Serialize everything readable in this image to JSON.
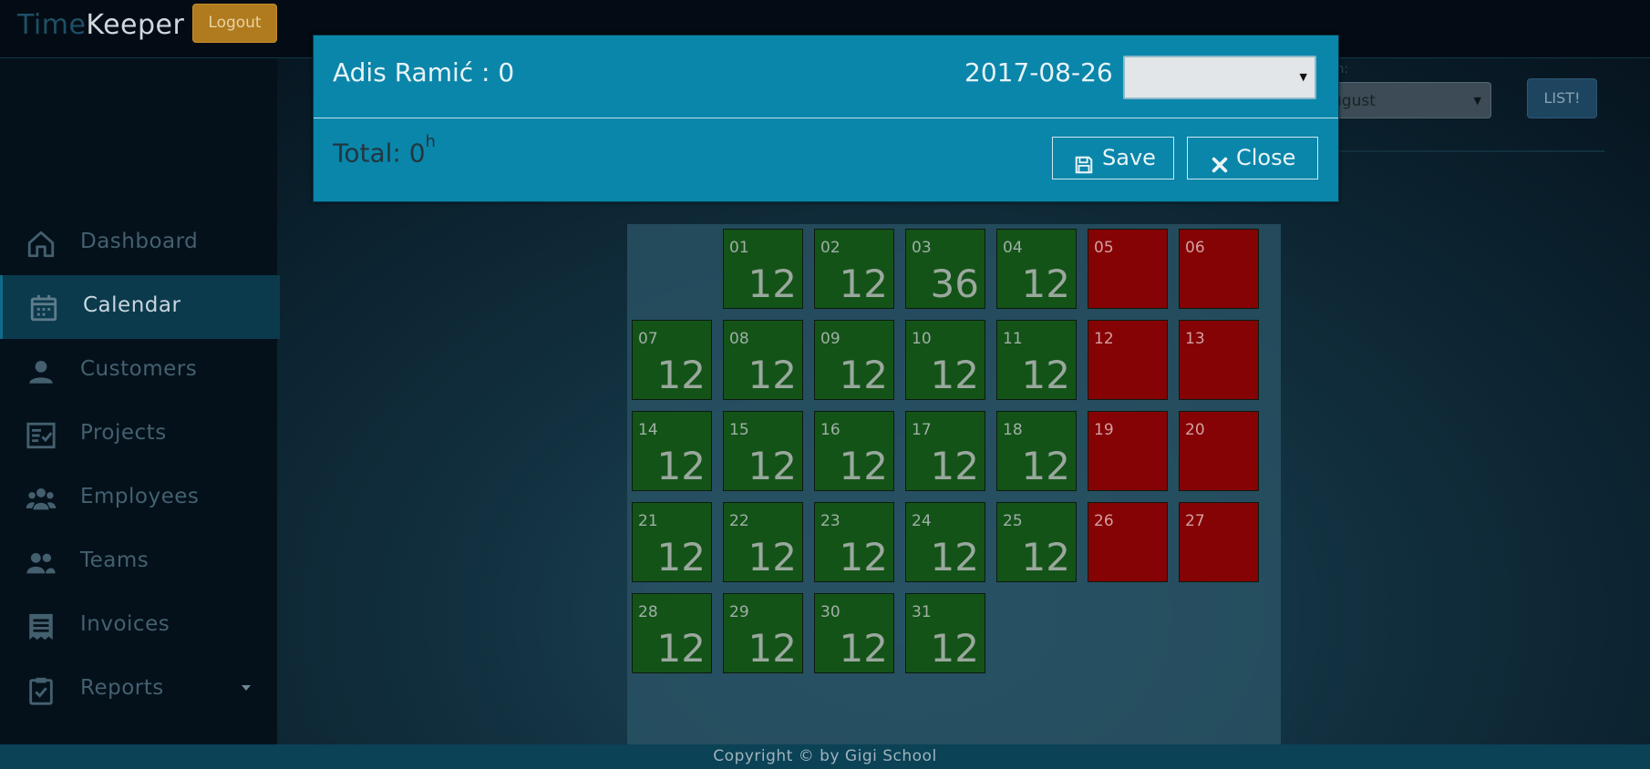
{
  "app": {
    "brand_part1": "Time",
    "brand_part2": "Keeper",
    "logout_label": "Logout"
  },
  "sidebar": {
    "items": [
      {
        "label": "Dashboard",
        "icon": "home-icon"
      },
      {
        "label": "Calendar",
        "icon": "calendar-icon",
        "active": true
      },
      {
        "label": "Customers",
        "icon": "customer-icon"
      },
      {
        "label": "Projects",
        "icon": "projects-icon"
      },
      {
        "label": "Employees",
        "icon": "employees-icon"
      },
      {
        "label": "Teams",
        "icon": "teams-icon"
      },
      {
        "label": "Invoices",
        "icon": "invoice-icon"
      },
      {
        "label": "Reports",
        "icon": "reports-icon",
        "has_dropdown": true
      }
    ]
  },
  "toolbar": {
    "month_label": "th:",
    "month_value": "ugust",
    "list_button": "LIST!"
  },
  "calendar": {
    "days": [
      {
        "day": "01",
        "hours": "12",
        "status": "work"
      },
      {
        "day": "02",
        "hours": "12",
        "status": "work"
      },
      {
        "day": "03",
        "hours": "36",
        "status": "work"
      },
      {
        "day": "04",
        "hours": "12",
        "status": "work"
      },
      {
        "day": "05",
        "hours": "",
        "status": "off"
      },
      {
        "day": "06",
        "hours": "",
        "status": "off"
      },
      {
        "day": "07",
        "hours": "12",
        "status": "work"
      },
      {
        "day": "08",
        "hours": "12",
        "status": "work"
      },
      {
        "day": "09",
        "hours": "12",
        "status": "work"
      },
      {
        "day": "10",
        "hours": "12",
        "status": "work"
      },
      {
        "day": "11",
        "hours": "12",
        "status": "work"
      },
      {
        "day": "12",
        "hours": "",
        "status": "off"
      },
      {
        "day": "13",
        "hours": "",
        "status": "off"
      },
      {
        "day": "14",
        "hours": "12",
        "status": "work"
      },
      {
        "day": "15",
        "hours": "12",
        "status": "work"
      },
      {
        "day": "16",
        "hours": "12",
        "status": "work"
      },
      {
        "day": "17",
        "hours": "12",
        "status": "work"
      },
      {
        "day": "18",
        "hours": "12",
        "status": "work"
      },
      {
        "day": "19",
        "hours": "",
        "status": "off"
      },
      {
        "day": "20",
        "hours": "",
        "status": "off"
      },
      {
        "day": "21",
        "hours": "12",
        "status": "work"
      },
      {
        "day": "22",
        "hours": "12",
        "status": "work"
      },
      {
        "day": "23",
        "hours": "12",
        "status": "work"
      },
      {
        "day": "24",
        "hours": "12",
        "status": "work"
      },
      {
        "day": "25",
        "hours": "12",
        "status": "work"
      },
      {
        "day": "26",
        "hours": "",
        "status": "off"
      },
      {
        "day": "27",
        "hours": "",
        "status": "off"
      },
      {
        "day": "28",
        "hours": "12",
        "status": "work"
      },
      {
        "day": "29",
        "hours": "12",
        "status": "work"
      },
      {
        "day": "30",
        "hours": "12",
        "status": "work"
      },
      {
        "day": "31",
        "hours": "12",
        "status": "work"
      }
    ],
    "colors": {
      "work": "#145318",
      "off": "#850205"
    }
  },
  "modal": {
    "title": "Adis Ramić : 0",
    "date": "2017-08-26",
    "select_value": "",
    "total_label": "Total: 0",
    "total_unit": "h",
    "save_label": "Save",
    "close_label": "Close",
    "accent_color": "#0a86aa"
  },
  "footer": {
    "copyright": "Copyright © by Gigi School"
  }
}
